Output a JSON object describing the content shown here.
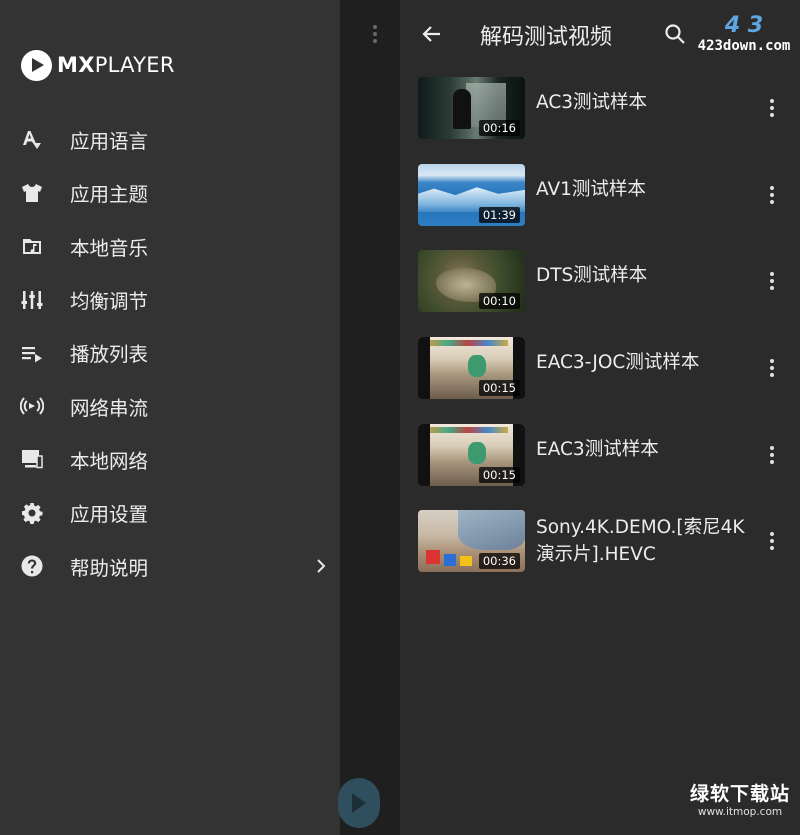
{
  "drawer": {
    "logo_bold": "MX",
    "logo_rest": "PLAYER",
    "items": [
      {
        "label": "应用语言",
        "icon": "language-icon"
      },
      {
        "label": "应用主题",
        "icon": "theme-shirt-icon"
      },
      {
        "label": "本地音乐",
        "icon": "music-folder-icon"
      },
      {
        "label": "均衡调节",
        "icon": "equalizer-icon"
      },
      {
        "label": "播放列表",
        "icon": "playlist-icon"
      },
      {
        "label": "网络串流",
        "icon": "stream-icon"
      },
      {
        "label": "本地网络",
        "icon": "local-network-icon"
      },
      {
        "label": "应用设置",
        "icon": "gear-icon"
      },
      {
        "label": "帮助说明",
        "icon": "help-icon"
      }
    ]
  },
  "panel": {
    "title": "解码测试视频",
    "videos": [
      {
        "title": "AC3测试样本",
        "duration": "00:16"
      },
      {
        "title": "AV1测试样本",
        "duration": "01:39"
      },
      {
        "title": "DTS测试样本",
        "duration": "00:10"
      },
      {
        "title": "EAC3-JOC测试样本",
        "duration": "00:15"
      },
      {
        "title": "EAC3测试样本",
        "duration": "00:15"
      },
      {
        "title": "Sony.4K.DEMO.[索尼4K演示片].HEVC",
        "duration": "00:36"
      }
    ]
  },
  "watermarks": {
    "top_logo": "4 3",
    "top_url": "423down.com",
    "bottom_main": "绿软下载站",
    "bottom_url": "www.itmop.com"
  }
}
